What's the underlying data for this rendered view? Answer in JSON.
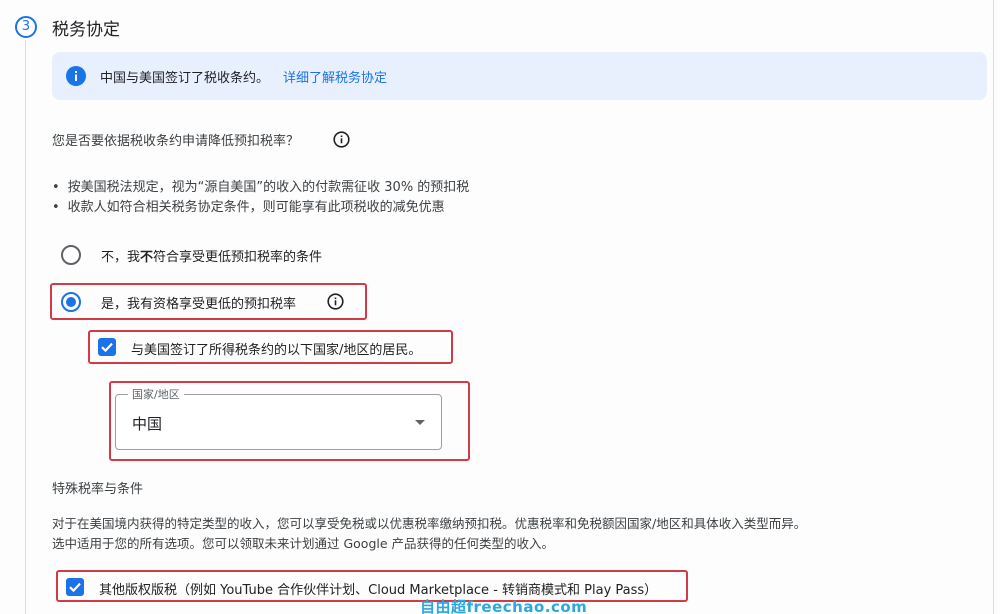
{
  "step": {
    "number": "3",
    "title": "税务协定"
  },
  "banner": {
    "icon": "info-icon",
    "text": "中国与美国签订了税收条约。",
    "link": "详细了解税务协定"
  },
  "question": {
    "text": "您是否要依据税收条约申请降低预扣税率？",
    "icon": "help-circle-icon"
  },
  "bullets": [
    "按美国税法规定，视为“源自美国”的收入的付款需征收 30% 的预扣税",
    "收款人如符合相关税务协定条件，则可能享有此项税收的减免优惠"
  ],
  "options": {
    "no": {
      "prefix": "不，我",
      "bold": "不",
      "suffix": "符合享受更低预扣税率的条件",
      "selected": false
    },
    "yes": {
      "label": "是，我有资格享受更低的预扣税率",
      "selected": true
    }
  },
  "resident_checkbox": {
    "label": "与美国签订了所得税条约的以下国家/地区的居民。",
    "checked": true
  },
  "country_select": {
    "label": "国家/地区",
    "value": "中国"
  },
  "special": {
    "title": "特殊税率与条件",
    "desc_line1": "对于在美国境内获得的特定类型的收入，您可以享受免税或以优惠税率缴纳预扣税。优惠税率和免税额因国家/地区和具体收入类型而异。",
    "desc_line2": "选中适用于您的所有选项。您可以领取未来计划通过 Google 产品获得的任何类型的收入。"
  },
  "royalty_checkbox": {
    "label": "其他版权版税（例如 YouTube 合作伙伴计划、Cloud Marketplace - 转销商模式和 Play Pass）",
    "checked": true
  },
  "watermark": "自由超freechao.com",
  "colors": {
    "accent": "#1a73e8",
    "highlight_box": "#d33a45",
    "banner_bg": "#e8f0fe"
  }
}
